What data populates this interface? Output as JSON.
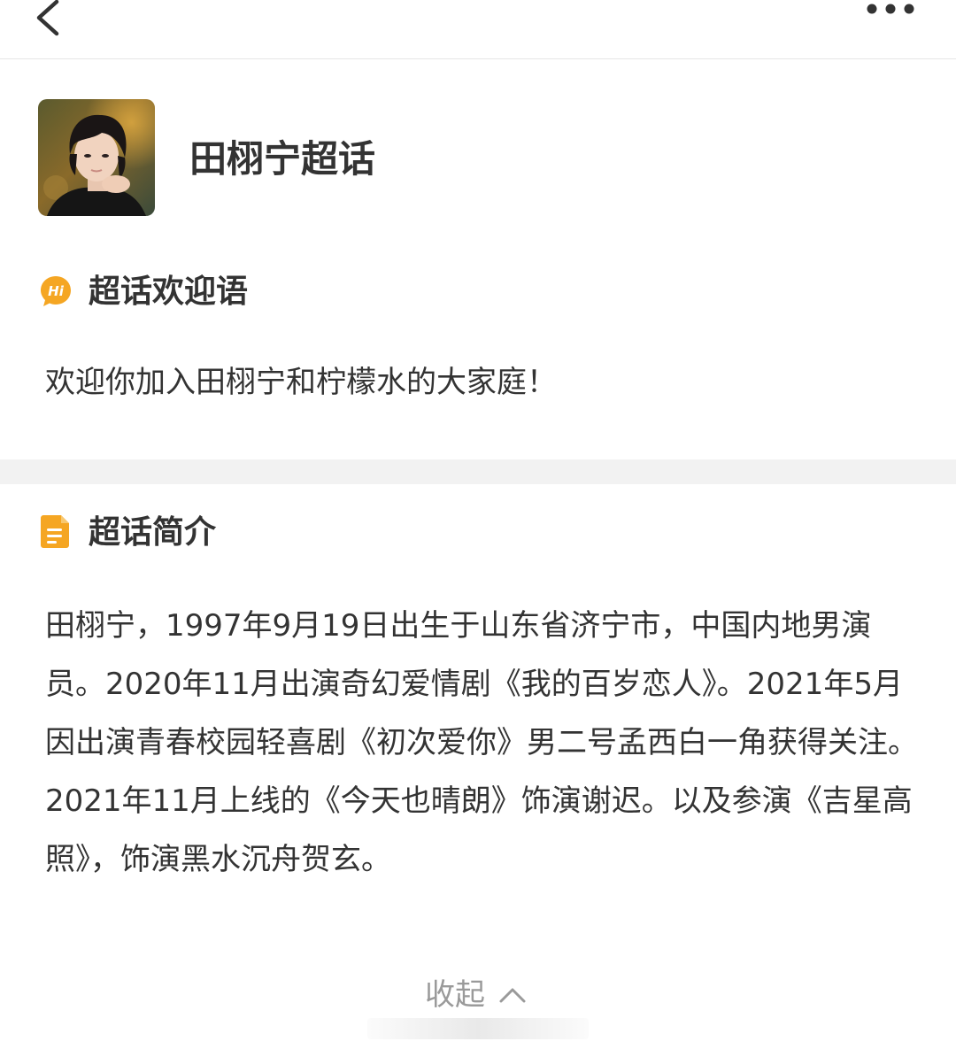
{
  "header": {
    "back_icon": "chevron-left-icon",
    "more_icon": "more-horizontal-icon"
  },
  "topic": {
    "title": "田栩宁超话",
    "avatar": "avatar-photo"
  },
  "welcome": {
    "icon": "hi-chat-bubble-icon",
    "section_title": "超话欢迎语",
    "text": "欢迎你加入田栩宁和柠檬水的大家庭！"
  },
  "intro": {
    "icon": "document-icon",
    "section_title": "超话简介",
    "text": "田栩宁，1997年9月19日出生于山东省济宁市，中国内地男演员。2020年11月出演奇幻爱情剧《我的百岁恋人》。2021年5月因出演青春校园轻喜剧《初次爱你》男二号孟西白一角获得关注。2021年11月上线的《今天也晴朗》饰演谢迟。以及参演《吉星高照》，饰演黑水沉舟贺玄。"
  },
  "collapse": {
    "label": "收起",
    "icon": "chevron-up-icon"
  },
  "colors": {
    "accent_orange": "#f5a623",
    "text_primary": "#333333",
    "text_muted": "#9a9a9a",
    "divider_gray": "#f2f2f2"
  }
}
